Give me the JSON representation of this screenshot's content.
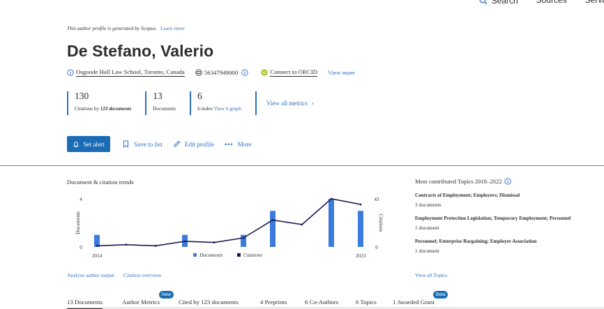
{
  "topnav": {
    "search": "Search",
    "sources": "Sources",
    "more": "Servi"
  },
  "notice": {
    "text": "This author profile is generated by Scopus.",
    "learn": "Learn more"
  },
  "author": {
    "name": "De Stefano, Valerio",
    "affiliation": "Osgoode Hall Law School, Toronto, Canada",
    "scopus_id": "56347949000",
    "orcid": "Connect to ORCID",
    "view_more": "View more"
  },
  "metrics": {
    "citations": {
      "value": "130",
      "label_prefix": "Citations by",
      "label_docs": "123 documents"
    },
    "documents": {
      "value": "13",
      "label": "Documents"
    },
    "hindex": {
      "value": "6",
      "label_h": "h",
      "label_rest": "-index",
      "link": "View h-graph"
    },
    "view_all": "View all metrics"
  },
  "actions": {
    "set_alert": "Set alert",
    "save_to_list": "Save to list",
    "edit_profile": "Edit profile",
    "more": "More"
  },
  "trends": {
    "title": "Document & citation trends",
    "links": {
      "analyze": "Analyze author output",
      "overview": "Citation overview"
    }
  },
  "chart_data": {
    "type": "bar",
    "x": [
      2014,
      2015,
      2016,
      2017,
      2018,
      2019,
      2020,
      2021,
      2022,
      2023
    ],
    "x_tick_labels": [
      "2014",
      "2023"
    ],
    "series": [
      {
        "name": "Documents",
        "type": "bar",
        "axis": "left",
        "values": [
          1,
          0,
          0,
          1,
          0,
          1,
          3,
          0,
          4,
          3
        ],
        "color": "#3b7bdb"
      },
      {
        "name": "Citations",
        "type": "line",
        "axis": "right",
        "values": [
          1,
          2,
          1,
          5,
          4,
          8,
          24,
          20,
          43,
          38
        ],
        "color": "#1b1a55"
      }
    ],
    "ylabel": "Documents",
    "y2label": "Citations",
    "ylim": [
      0,
      4
    ],
    "y2lim": [
      0,
      43
    ],
    "y_ticks": [
      "0",
      "4"
    ],
    "y2_ticks": [
      "0",
      "43"
    ],
    "legend_position": "bottom"
  },
  "topics": {
    "title": "Most contributed Topics 2018–2022",
    "items": [
      {
        "name": "Contracts of Employment; Employers; Dismissal",
        "docs": "3 documents"
      },
      {
        "name": "Employment Protection Legislation; Temporary Employment; Personnel",
        "docs": "1 document"
      },
      {
        "name": "Personnel; Enterprise Bargaining; Employer Association",
        "docs": "1 document"
      }
    ],
    "view_all": "View all Topics"
  },
  "tabs": [
    {
      "label": "13 Documents",
      "active": true
    },
    {
      "label": "Author Metrics",
      "badge": "New"
    },
    {
      "label": "Cited by 123 documents"
    },
    {
      "label": "4 Preprints"
    },
    {
      "label": "6 Co-Authors"
    },
    {
      "label": "6 Topics"
    },
    {
      "label": "1 Awarded Grant",
      "badge": "Beta"
    }
  ],
  "colors": {
    "accent": "#1a6db4",
    "link": "#2e6fc2",
    "bar": "#3b7bdb",
    "line": "#1b1a55",
    "orcid": "#a6ce39"
  }
}
